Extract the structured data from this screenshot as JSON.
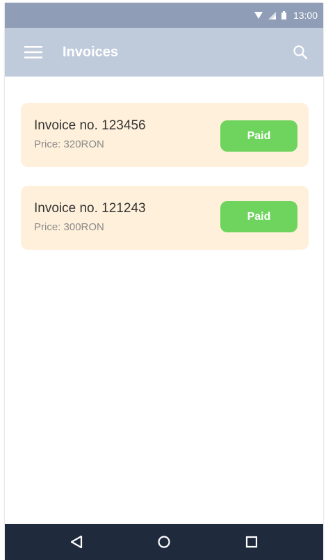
{
  "status_bar": {
    "time": "13:00",
    "icons": [
      "wifi-icon",
      "signal-icon",
      "battery-icon"
    ]
  },
  "app_bar": {
    "title": "Invoices",
    "menu_icon": "hamburger-menu-icon",
    "search_icon": "search-icon"
  },
  "invoices": [
    {
      "title": "Invoice no. 123456",
      "price": "Price: 320RON",
      "status": "Paid"
    },
    {
      "title": "Invoice no. 121243",
      "price": "Price: 300RON",
      "status": "Paid"
    }
  ],
  "nav_bar": {
    "icons": [
      "back-icon",
      "home-icon",
      "recents-icon"
    ]
  },
  "colors": {
    "status_bar": "#8f9eb6",
    "app_bar": "#bfcbdb",
    "card_bg": "#fff0db",
    "paid_green": "#6ed45e",
    "nav_bar": "#1f2b3c"
  }
}
